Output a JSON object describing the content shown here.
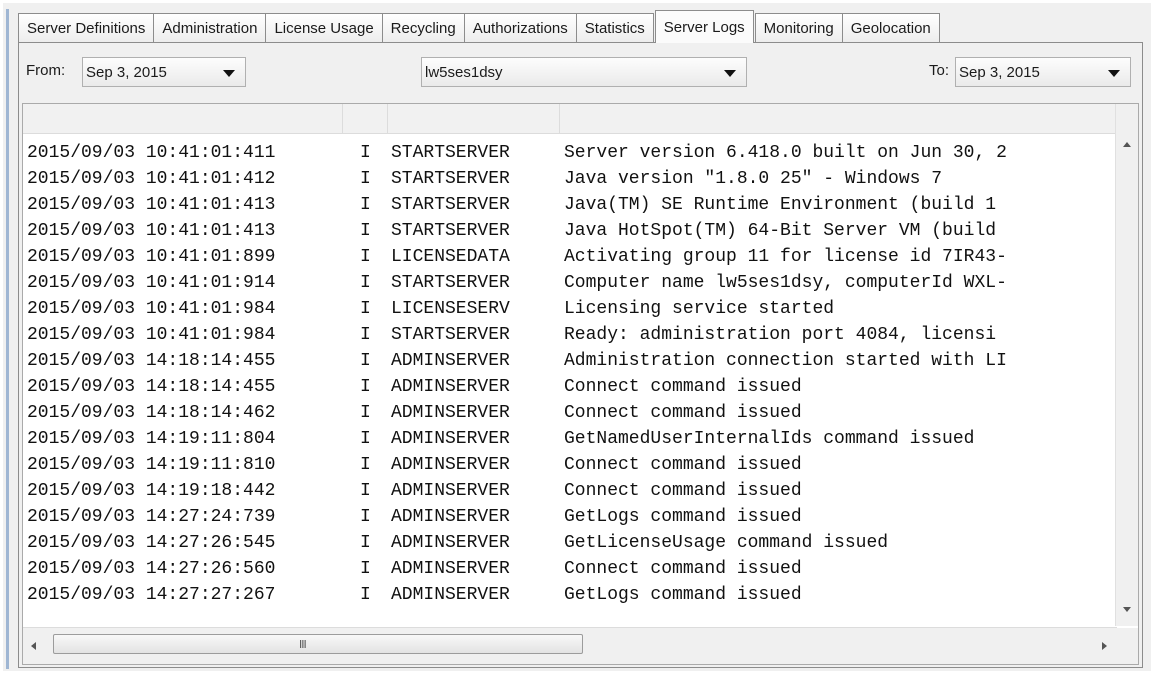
{
  "tabs": [
    {
      "label": "Server Definitions",
      "active": false
    },
    {
      "label": "Administration",
      "active": false
    },
    {
      "label": "License Usage",
      "active": false
    },
    {
      "label": "Recycling",
      "active": false
    },
    {
      "label": "Authorizations",
      "active": false
    },
    {
      "label": "Statistics",
      "active": false
    },
    {
      "label": "Server Logs",
      "active": true
    },
    {
      "label": "Monitoring",
      "active": false
    },
    {
      "label": "Geolocation",
      "active": false
    }
  ],
  "filters": {
    "from_label": "From:",
    "from_value": "Sep 3, 2015",
    "server_value": "lw5ses1dsy",
    "to_label": "To:",
    "to_value": "Sep 3, 2015"
  },
  "logs": [
    {
      "ts": "2015/09/03 10:41:01:411",
      "level": "I",
      "source": "STARTSERVER",
      "message": "Server version 6.418.0 built on Jun 30, 2"
    },
    {
      "ts": "2015/09/03 10:41:01:412",
      "level": "I",
      "source": "STARTSERVER",
      "message": "Java version \"1.8.0 25\" - Windows 7"
    },
    {
      "ts": "2015/09/03 10:41:01:413",
      "level": "I",
      "source": "STARTSERVER",
      "message": "Java(TM) SE Runtime Environment (build 1"
    },
    {
      "ts": "2015/09/03 10:41:01:413",
      "level": "I",
      "source": "STARTSERVER",
      "message": "Java HotSpot(TM) 64-Bit Server VM (build"
    },
    {
      "ts": "2015/09/03 10:41:01:899",
      "level": "I",
      "source": "LICENSEDATA",
      "message": "Activating group 11 for license id 7IR43-"
    },
    {
      "ts": "2015/09/03 10:41:01:914",
      "level": "I",
      "source": "STARTSERVER",
      "message": "Computer name lw5ses1dsy, computerId WXL-"
    },
    {
      "ts": "2015/09/03 10:41:01:984",
      "level": "I",
      "source": "LICENSESERV",
      "message": "Licensing service started"
    },
    {
      "ts": "2015/09/03 10:41:01:984",
      "level": "I",
      "source": "STARTSERVER",
      "message": "Ready: administration port 4084, licensi"
    },
    {
      "ts": "2015/09/03 14:18:14:455",
      "level": "I",
      "source": "ADMINSERVER",
      "message": "Administration connection started with LI"
    },
    {
      "ts": "2015/09/03 14:18:14:455",
      "level": "I",
      "source": "ADMINSERVER",
      "message": "Connect command issued"
    },
    {
      "ts": "2015/09/03 14:18:14:462",
      "level": "I",
      "source": "ADMINSERVER",
      "message": "Connect command issued"
    },
    {
      "ts": "2015/09/03 14:19:11:804",
      "level": "I",
      "source": "ADMINSERVER",
      "message": "GetNamedUserInternalIds command issued"
    },
    {
      "ts": "2015/09/03 14:19:11:810",
      "level": "I",
      "source": "ADMINSERVER",
      "message": "Connect command issued"
    },
    {
      "ts": "2015/09/03 14:19:18:442",
      "level": "I",
      "source": "ADMINSERVER",
      "message": "Connect command issued"
    },
    {
      "ts": "2015/09/03 14:27:24:739",
      "level": "I",
      "source": "ADMINSERVER",
      "message": "GetLogs command issued"
    },
    {
      "ts": "2015/09/03 14:27:26:545",
      "level": "I",
      "source": "ADMINSERVER",
      "message": "GetLicenseUsage command issued"
    },
    {
      "ts": "2015/09/03 14:27:26:560",
      "level": "I",
      "source": "ADMINSERVER",
      "message": "Connect command issued"
    },
    {
      "ts": "2015/09/03 14:27:27:267",
      "level": "I",
      "source": "ADMINSERVER",
      "message": "GetLogs command issued"
    }
  ],
  "scrollbar": {
    "grip": "III"
  },
  "icons": [
    "chevron-down-icon",
    "scroll-up-icon",
    "scroll-down-icon",
    "scroll-left-icon",
    "scroll-right-icon"
  ]
}
